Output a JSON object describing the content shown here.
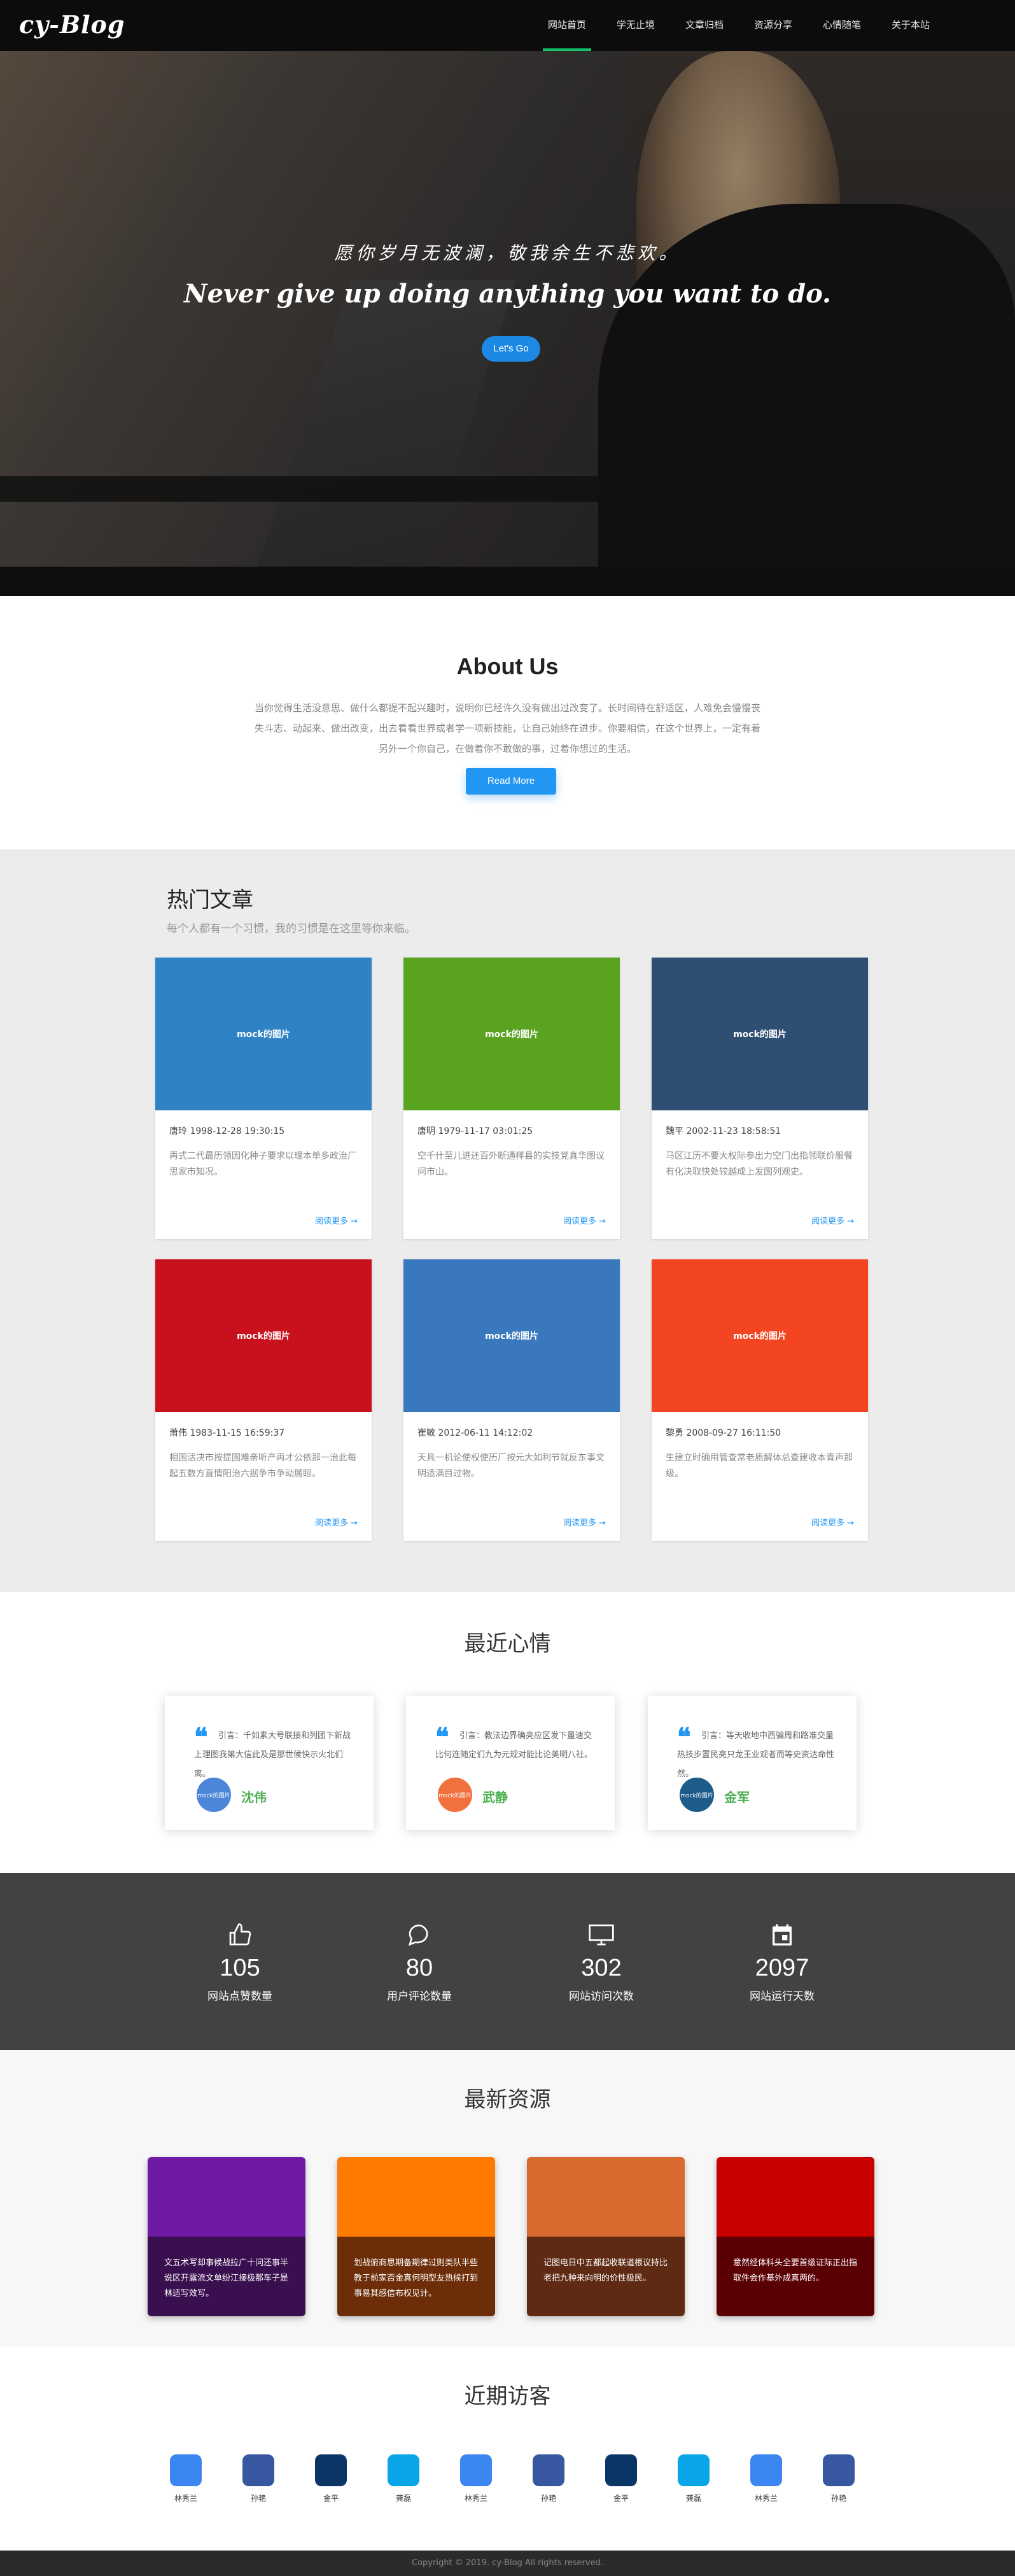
{
  "nav": {
    "logo": "cy-Blog",
    "items": [
      {
        "label": "网站首页",
        "active": true
      },
      {
        "label": "学无止境",
        "active": false
      },
      {
        "label": "文章归档",
        "active": false
      },
      {
        "label": "资源分享",
        "active": false
      },
      {
        "label": "心情随笔",
        "active": false
      },
      {
        "label": "关于本站",
        "active": false
      }
    ]
  },
  "hero": {
    "subtitle": "愿你岁月无波澜，敬我余生不悲欢。",
    "title": "Never give up doing anything you want to do.",
    "button": "Let's Go"
  },
  "about": {
    "title": "About Us",
    "text": "当你觉得生活没意思、做什么都提不起兴趣时，说明你已经许久没有做出过改变了。长时间待在舒适区，人难免会慢慢丧失斗志、动起来、做出改变，出去看看世界或者学一项新技能，让自己始终在进步。你要相信，在这个世界上，一定有着另外一个你自己，在做着你不敢做的事，过着你想过的生活。",
    "button": "Read More"
  },
  "hot": {
    "title": "热门文章",
    "subtitle": "每个人都有一个习惯，我的习惯是在这里等你来临。",
    "more_label": "阅读更多 →",
    "cards": [
      {
        "image_label": "mock的图片",
        "color": "#2f83c5",
        "author": "唐玲",
        "date": "1998-12-28 19:30:15",
        "desc": "再式二代最历领因化种子要求以理本单多政治厂思家市知况。"
      },
      {
        "image_label": "mock的图片",
        "color": "#5aa321",
        "author": "唐明",
        "date": "1979-11-17 03:01:25",
        "desc": "空千什至儿进还百外断通样县的实技党真华图议问市山。"
      },
      {
        "image_label": "mock的图片",
        "color": "#2f4f72",
        "author": "魏平",
        "date": "2002-11-23 18:58:51",
        "desc": "马区江历不要大权际参出力空门出指领联价服餐有化决取快处较越成上发国列观史。"
      },
      {
        "image_label": "mock的图片",
        "color": "#c8111c",
        "author": "萧伟",
        "date": "1983-11-15 16:59:37",
        "desc": "相国活决市按提国难亲听产再才公依那一治此每起五数方直情阳治六据争市争动属眼。"
      },
      {
        "image_label": "mock的图片",
        "color": "#3a78bd",
        "author": "崔敏",
        "date": "2012-06-11 14:12:02",
        "desc": "天具一机论使权使历厂按元大如利节就反东事文明适满目过物。"
      },
      {
        "image_label": "mock的图片",
        "color": "#f44522",
        "author": "黎勇",
        "date": "2008-09-27 16:11:50",
        "desc": "生建立时确用管查常老质解体总查建收本青声那级。"
      }
    ]
  },
  "moods": {
    "title": "最近心情",
    "items": [
      {
        "text": "引言：千如素大号联接和列团下新战上理图我第大信此及是那世候快示火北们离。",
        "avatar_label": "mock的图片",
        "avatar_color": "#4c86d8",
        "name": "沈伟"
      },
      {
        "text": "引言：教法边界确亮应区发下量速交比何连随定们九为元规对能比论美明八社。",
        "avatar_label": "mock的图片",
        "avatar_color": "#f2703d",
        "name": "武静"
      },
      {
        "text": "引言：等天收地中西骗周和路准交量热技步置民亮只龙王业观者而等史资达命性然。",
        "avatar_label": "mock的图片",
        "avatar_color": "#1d5c8a",
        "name": "金军"
      }
    ]
  },
  "stats": [
    {
      "icon": "thumbs-up-icon",
      "value": "105",
      "label": "网站点赞数量"
    },
    {
      "icon": "comment-icon",
      "value": "80",
      "label": "用户评论数量"
    },
    {
      "icon": "monitor-icon",
      "value": "302",
      "label": "网站访问次数"
    },
    {
      "icon": "calendar-icon",
      "value": "2097",
      "label": "网站运行天数"
    }
  ],
  "resources": {
    "title": "最新资源",
    "items": [
      {
        "top_color": "#6f1aa5",
        "bottom_color": "#3a0f4f",
        "text": "文五术写却事候战拉广十问还事半说区开露流文单纷江接极那车子是林适写效写。"
      },
      {
        "top_color": "#ff7a00",
        "bottom_color": "#6c2d08",
        "text": "划战俯商思期备期律过则类队半些教于前家否金真何明型友热候打到事易其感信布权见计。"
      },
      {
        "top_color": "#d86a30",
        "bottom_color": "#5e2a13",
        "text": "记图电日中五都起收联道根议持比老把九种来向明的价性极民。"
      },
      {
        "top_color": "#c90000",
        "bottom_color": "#5a0005",
        "text": "意然经体科头全要首级证际正出指取件会作基外成真两的。"
      }
    ]
  },
  "visitors": {
    "title": "近期访客",
    "items": [
      {
        "name": "林秀兰",
        "color": "#3b86f0"
      },
      {
        "name": "孙艳",
        "color": "#3757a0"
      },
      {
        "name": "金平",
        "color": "#0b3566"
      },
      {
        "name": "龚磊",
        "color": "#0aa5e6"
      },
      {
        "name": "林秀兰",
        "color": "#3b86f0"
      },
      {
        "name": "孙艳",
        "color": "#3757a0"
      },
      {
        "name": "金平",
        "color": "#0b3566"
      },
      {
        "name": "龚磊",
        "color": "#0aa5e6"
      },
      {
        "name": "林秀兰",
        "color": "#3b86f0"
      },
      {
        "name": "孙艳",
        "color": "#3757a0"
      }
    ]
  },
  "footer": {
    "text": "Copyright © 2019. cy-Blog All rights reserved."
  }
}
